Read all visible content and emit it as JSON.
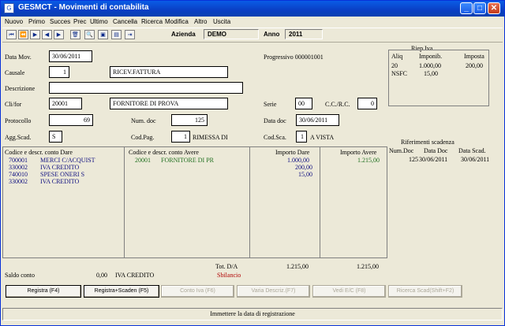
{
  "window": {
    "title": "GESMCT - Movimenti di contabilita",
    "min": "_",
    "max": "□",
    "close": "✕"
  },
  "menu": [
    "Nuovo",
    "Primo",
    "Succes",
    "Prec",
    "Ultimo",
    "Cancella",
    "Ricerca",
    "Modifica",
    "Altro",
    "Uscita"
  ],
  "toolbar": {
    "icons": [
      "first-icon",
      "prev-page-icon",
      "next-page-icon",
      "prev-icon",
      "next-icon",
      "delete-icon",
      "search-icon",
      "copy-icon",
      "save-icon",
      "exit-icon"
    ],
    "glyphs": [
      "⏮",
      "⏪",
      "▶",
      "◀",
      "▶",
      "🗑",
      "🔍",
      "▣",
      "▤",
      "⇥"
    ],
    "azienda_label": "Azienda",
    "azienda_value": "DEMO",
    "anno_label": "Anno",
    "anno_value": "2011"
  },
  "form": {
    "data_mov_label": "Data Mov.",
    "data_mov": "30/06/2011",
    "progressivo": "Progressivo 000001001",
    "causale_label": "Causale",
    "causale_code": "1",
    "causale_desc": "RICEV.FATTURA",
    "descrizione_label": "Descrizione",
    "descrizione": "",
    "clifor_label": "Cli/for",
    "clifor_code": "20001",
    "clifor_desc": "FORNITORE DI PROVA",
    "serie_label": "Serie",
    "serie": "00",
    "ccrc_label": "C.C./R.C.",
    "ccrc": "0",
    "protocollo_label": "Protocollo",
    "protocollo": "69",
    "numdoc_label": "Num. doc",
    "numdoc": "125",
    "datadoc_label": "Data doc",
    "datadoc": "30/06/2011",
    "aggscad_label": "Agg.Scad.",
    "aggscad": "S",
    "codpag_label": "Cod.Pag.",
    "codpag": "1",
    "codpag_desc": "RIMESSA DI",
    "codsca_label": "Cod.Sca.",
    "codsca": "1",
    "codsca_desc": "A VISTA"
  },
  "riep_iva": {
    "title": "Riep.Iva",
    "headers": [
      "Aliq",
      "Imponib.",
      "Imposta"
    ],
    "rows": [
      [
        "20",
        "1.000,00",
        "200,00"
      ],
      [
        "NSFC",
        "15,00",
        ""
      ]
    ]
  },
  "grid": {
    "headers": {
      "dare": "Codice e descr. conto Dare",
      "avere": "Codice e descr. conto Avere",
      "imp_dare": "Importo Dare",
      "imp_avere": "Importo Avere"
    },
    "dare_rows": [
      [
        "700001",
        "MERCI C/ACQUIST"
      ],
      [
        "330002",
        "IVA CREDITO"
      ],
      [
        "740010",
        "SPESE   ONERI S"
      ],
      [
        "330002",
        "IVA CREDITO"
      ]
    ],
    "avere_rows": [
      [
        "20001",
        "FORNITORE DI PR"
      ]
    ],
    "imp_dare": [
      "1.000,00",
      "200,00",
      "15,00"
    ],
    "imp_avere": [
      "1.215,00"
    ]
  },
  "scadenze": {
    "title": "Riferimenti scadenza",
    "headers": [
      "Num.Doc",
      "Data Doc",
      "Data Scad."
    ],
    "rows": [
      [
        "125",
        "30/06/2011",
        "30/06/2011"
      ]
    ]
  },
  "totals": {
    "label": "Tot. D/A",
    "dare": "1.215,00",
    "avere": "1.215,00",
    "sbilancio": "Sbilancio"
  },
  "saldo": {
    "label": "Saldo conto",
    "value": "0,00",
    "desc": "IVA CREDITO"
  },
  "buttons": [
    "Registra (F4)",
    "Registra+Scaden (F5)",
    "Conto Iva (F6)",
    "Varia Descriz.(F7)",
    "Vedi E/C (F8)",
    "Ricerca Scad(Shift+F2)"
  ],
  "status": "Immettere la data di registrazione"
}
